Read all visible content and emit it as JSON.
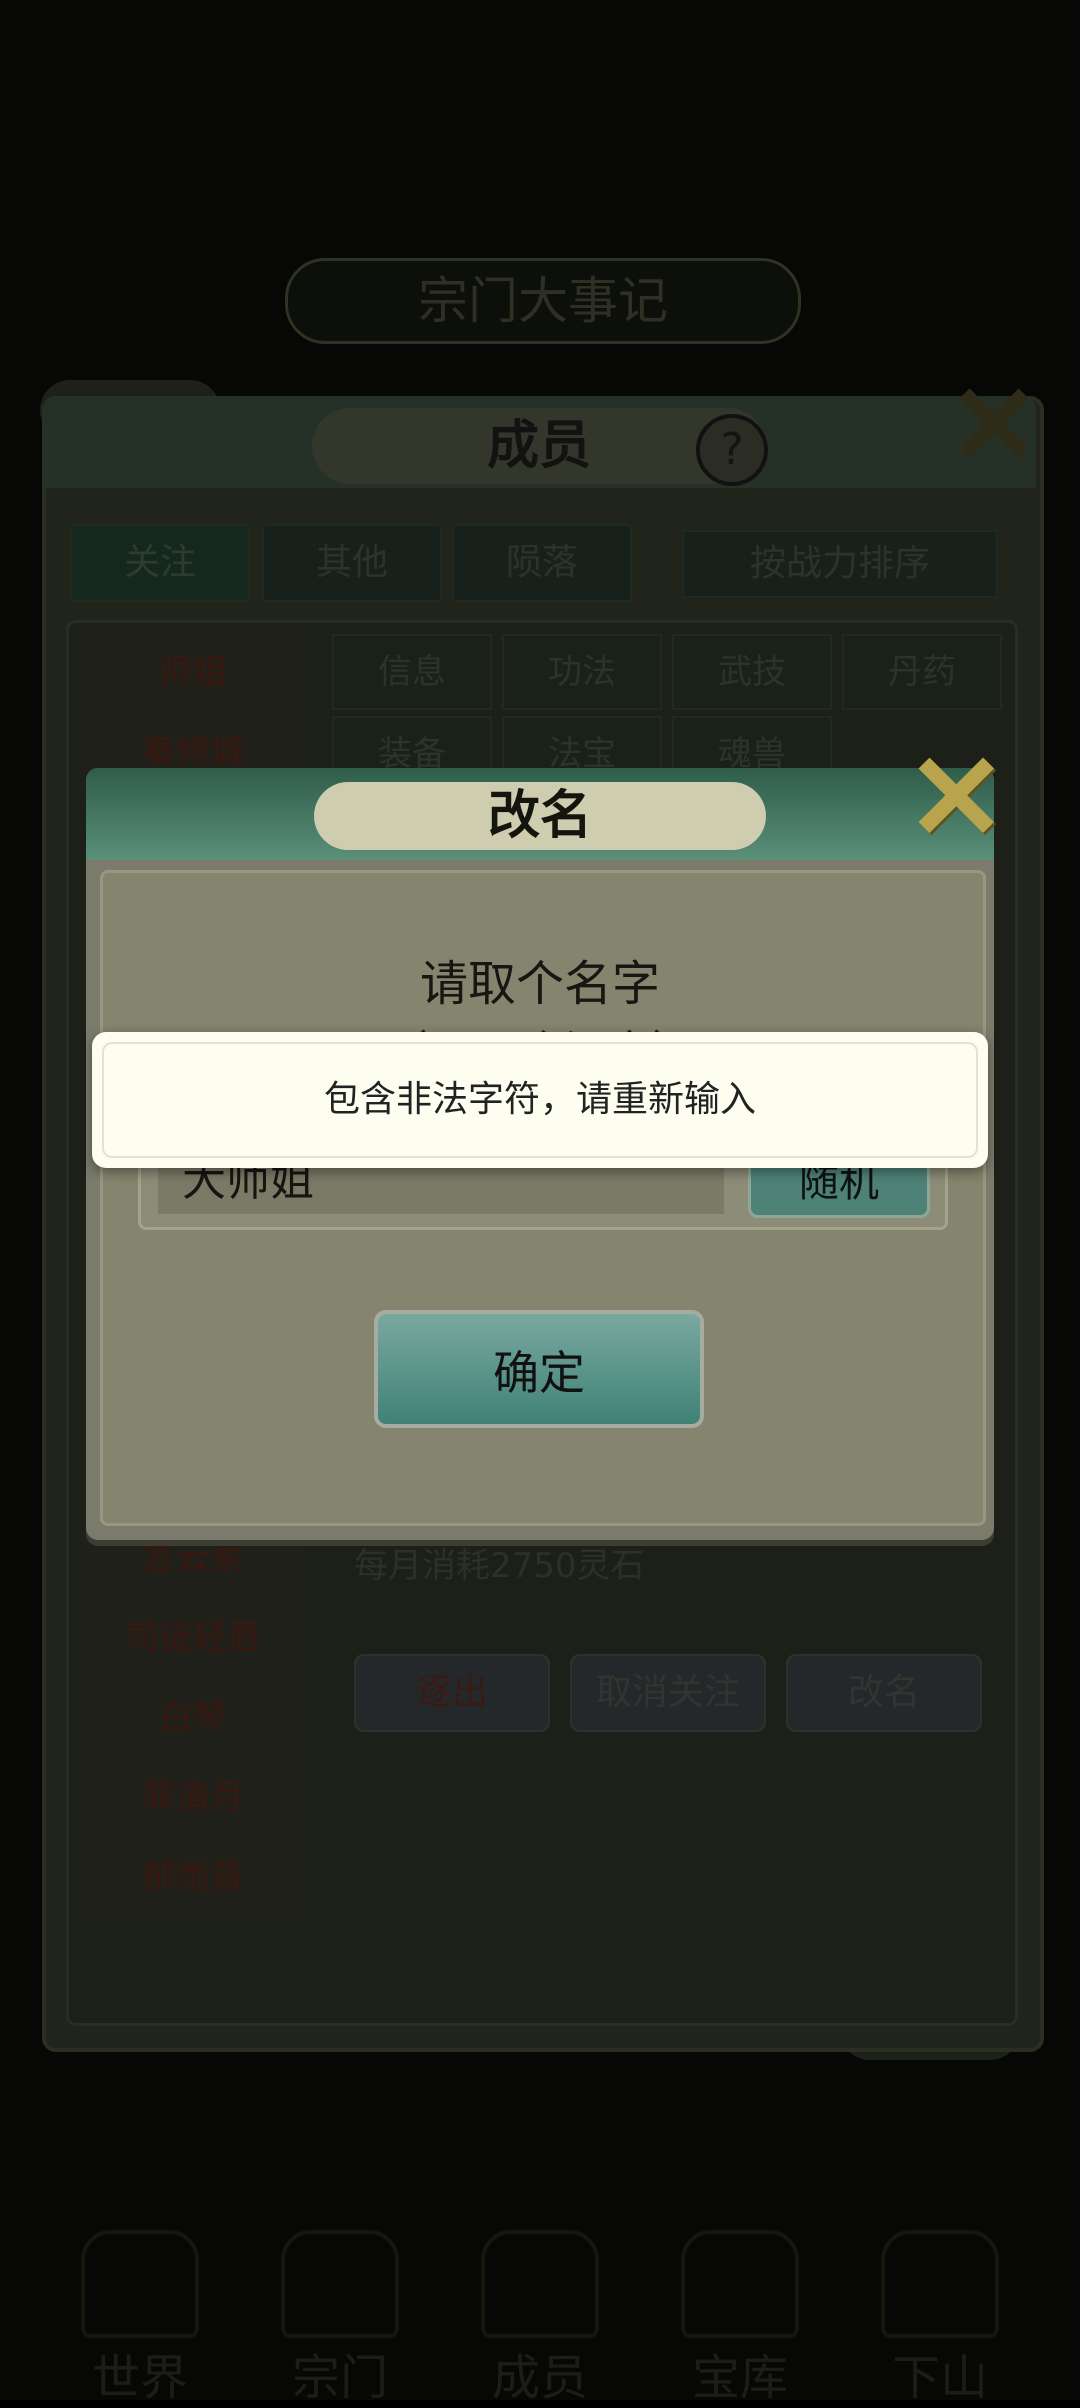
{
  "background": {
    "chronicle_label": "宗门大事记",
    "panel_title": "成员",
    "help_symbol": "?",
    "close_symbol": "✕",
    "top_tabs": [
      "关注",
      "其他",
      "陨落"
    ],
    "sort_label": "按战力排序",
    "members": [
      "师姐",
      "秦倾城",
      "言云萦",
      "司徒轻眉",
      "白琴",
      "菲清月",
      "郁雨薇"
    ],
    "sub_tabs_row1": [
      "信息",
      "功法",
      "武技",
      "丹药"
    ],
    "sub_tabs_row2": [
      "装备",
      "法宝",
      "魂兽"
    ],
    "monthly_cost": "每月消耗2750灵石",
    "action_buttons": [
      "逐出",
      "取消关注",
      "改名"
    ],
    "bottom_nav": [
      "世界",
      "宗门",
      "成员",
      "宝库",
      "下山"
    ]
  },
  "modal": {
    "title": "改名",
    "close_symbol": "✕",
    "prompt": "请取个名字",
    "prompt_sub": "（1~6个汉字）",
    "name_value": "大师姐",
    "random_label": "随机",
    "confirm_label": "确定"
  },
  "toast": {
    "message": "包含非法字符，请重新输入"
  }
}
